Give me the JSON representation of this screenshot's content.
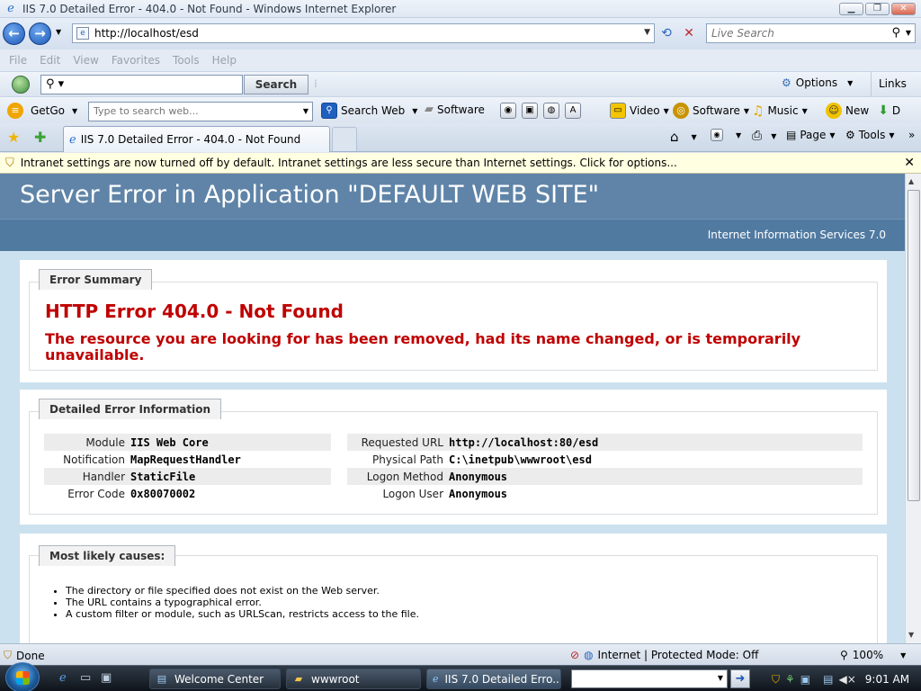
{
  "window": {
    "title": "IIS 7.0 Detailed Error - 404.0 - Not Found - Windows Internet Explorer",
    "minimize": "▁",
    "maximize": "❐",
    "close": "✕"
  },
  "nav": {
    "back": "←",
    "forward": "→",
    "address": "http://localhost/esd",
    "refresh": "⟲",
    "stop": "✕",
    "live_search_placeholder": "Live Search"
  },
  "menu": [
    "File",
    "Edit",
    "View",
    "Favorites",
    "Tools",
    "Help"
  ],
  "search_toolbar": {
    "button": "Search",
    "options": "Options",
    "links": "Links"
  },
  "getgo_toolbar": {
    "getgo": "GetGo",
    "web_placeholder": "Type to search web...",
    "search_web": "Search Web",
    "software": "Software",
    "video": "Video",
    "software2": "Software",
    "music": "Music",
    "new": "New",
    "cut": "D"
  },
  "tabs": {
    "active_tab": "IIS 7.0 Detailed Error - 404.0 - Not Found",
    "page": "Page",
    "tools": "Tools"
  },
  "infobar": {
    "message": "Intranet settings are now turned off by default. Intranet settings are less secure than Internet settings. Click for options..."
  },
  "page": {
    "heading": "Server Error in Application \"DEFAULT WEB SITE\"",
    "server": "Internet Information Services 7.0",
    "summary": {
      "legend": "Error Summary",
      "error": "HTTP Error 404.0 - Not Found",
      "description": "The resource you are looking for has been removed, had its name changed, or is temporarily unavailable."
    },
    "details": {
      "legend": "Detailed Error Information",
      "left": [
        {
          "k": "Module",
          "v": "IIS Web Core"
        },
        {
          "k": "Notification",
          "v": "MapRequestHandler"
        },
        {
          "k": "Handler",
          "v": "StaticFile"
        },
        {
          "k": "Error Code",
          "v": "0x80070002"
        }
      ],
      "right": [
        {
          "k": "Requested URL",
          "v": "http://localhost:80/esd"
        },
        {
          "k": "Physical Path",
          "v": "C:\\inetpub\\wwwroot\\esd"
        },
        {
          "k": "Logon Method",
          "v": "Anonymous"
        },
        {
          "k": "Logon User",
          "v": "Anonymous"
        }
      ]
    },
    "causes": {
      "legend": "Most likely causes:",
      "items": [
        "The directory or file specified does not exist on the Web server.",
        "The URL contains a typographical error.",
        "A custom filter or module, such as URLScan, restricts access to the file."
      ]
    }
  },
  "status": {
    "left": "Done",
    "zone": "Internet | Protected Mode: Off",
    "zoom": "100%"
  },
  "taskbar": {
    "items": [
      "Welcome Center",
      "wwwroot",
      "IIS 7.0 Detailed Erro..."
    ],
    "clock": "9:01 AM"
  }
}
